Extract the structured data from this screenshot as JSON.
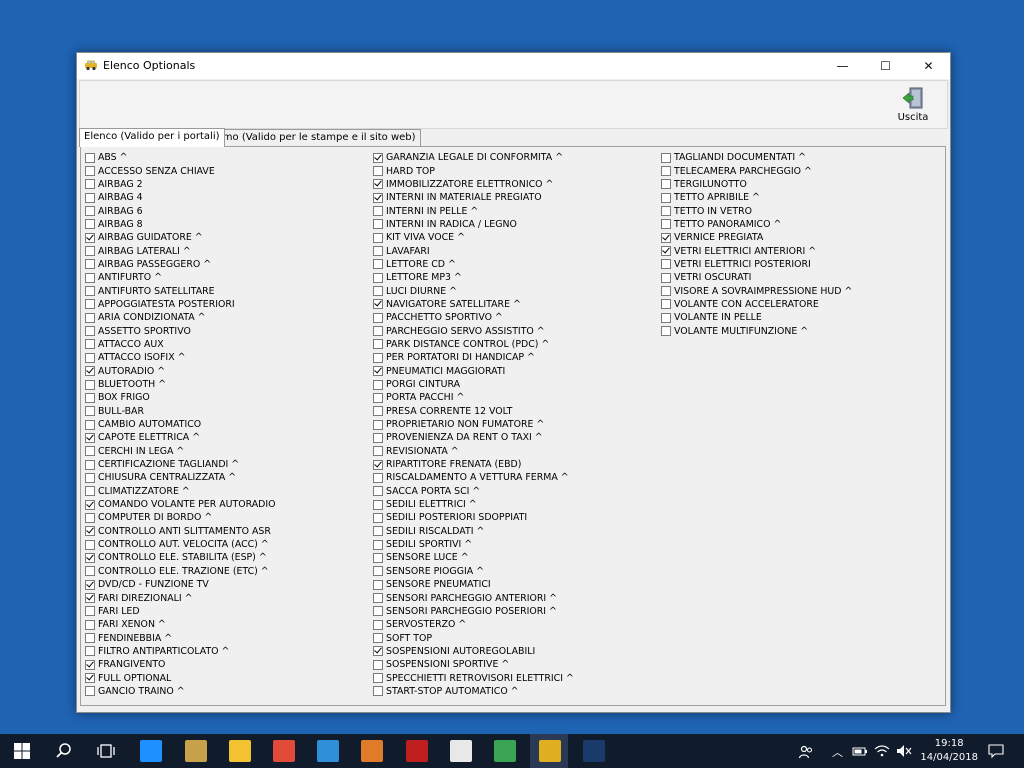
{
  "window": {
    "title": "Elenco Optionals",
    "minimize": "—",
    "maximize": "☐",
    "close": "✕"
  },
  "toolbar": {
    "exit_label": "Uscita"
  },
  "tabs": [
    {
      "label": "Elenco (Valido per i portali)",
      "active": true
    },
    {
      "label": "Memo (Valido per le stampe e il sito web)",
      "active": false
    }
  ],
  "columns": [
    [
      {
        "label": "ABS ^",
        "checked": false
      },
      {
        "label": "ACCESSO SENZA CHIAVE",
        "checked": false
      },
      {
        "label": "AIRBAG 2",
        "checked": false
      },
      {
        "label": "AIRBAG 4",
        "checked": false
      },
      {
        "label": "AIRBAG 6",
        "checked": false
      },
      {
        "label": "AIRBAG 8",
        "checked": false
      },
      {
        "label": "AIRBAG GUIDATORE ^",
        "checked": true
      },
      {
        "label": "AIRBAG LATERALI ^",
        "checked": false
      },
      {
        "label": "AIRBAG PASSEGGERO ^",
        "checked": false
      },
      {
        "label": "ANTIFURTO ^",
        "checked": false
      },
      {
        "label": "ANTIFURTO SATELLITARE",
        "checked": false
      },
      {
        "label": "APPOGGIATESTA POSTERIORI",
        "checked": false
      },
      {
        "label": "ARIA CONDIZIONATA ^",
        "checked": false
      },
      {
        "label": "ASSETTO SPORTIVO",
        "checked": false
      },
      {
        "label": "ATTACCO AUX",
        "checked": false
      },
      {
        "label": "ATTACCO ISOFIX ^",
        "checked": false
      },
      {
        "label": "AUTORADIO ^",
        "checked": true
      },
      {
        "label": "BLUETOOTH ^",
        "checked": false
      },
      {
        "label": "BOX FRIGO",
        "checked": false
      },
      {
        "label": "BULL-BAR",
        "checked": false
      },
      {
        "label": "CAMBIO AUTOMATICO",
        "checked": false
      },
      {
        "label": "CAPOTE ELETTRICA ^",
        "checked": true
      },
      {
        "label": "CERCHI IN LEGA ^",
        "checked": false
      },
      {
        "label": "CERTIFICAZIONE TAGLIANDI ^",
        "checked": false
      },
      {
        "label": "CHIUSURA CENTRALIZZATA ^",
        "checked": false
      },
      {
        "label": "CLIMATIZZATORE ^",
        "checked": false
      },
      {
        "label": "COMANDO VOLANTE PER AUTORADIO",
        "checked": true
      },
      {
        "label": "COMPUTER DI BORDO ^",
        "checked": false
      },
      {
        "label": "CONTROLLO ANTI SLITTAMENTO ASR",
        "checked": true
      },
      {
        "label": "CONTROLLO AUT. VELOCITA (ACC) ^",
        "checked": false
      },
      {
        "label": "CONTROLLO ELE. STABILITA (ESP) ^",
        "checked": true
      },
      {
        "label": "CONTROLLO ELE. TRAZIONE (ETC) ^",
        "checked": false
      },
      {
        "label": "DVD/CD - FUNZIONE TV",
        "checked": true
      },
      {
        "label": "FARI DIREZIONALI ^",
        "checked": true
      },
      {
        "label": "FARI LED",
        "checked": false
      },
      {
        "label": "FARI XENON ^",
        "checked": false
      },
      {
        "label": "FENDINEBBIA ^",
        "checked": false
      },
      {
        "label": "FILTRO ANTIPARTICOLATO ^",
        "checked": false
      },
      {
        "label": "FRANGIVENTO",
        "checked": true
      },
      {
        "label": "FULL OPTIONAL",
        "checked": true
      },
      {
        "label": "GANCIO TRAINO ^",
        "checked": false
      }
    ],
    [
      {
        "label": "GARANZIA LEGALE DI CONFORMITA ^",
        "checked": true
      },
      {
        "label": "HARD TOP",
        "checked": false
      },
      {
        "label": "IMMOBILIZZATORE ELETTRONICO ^",
        "checked": true
      },
      {
        "label": "INTERNI IN MATERIALE PREGIATO",
        "checked": true
      },
      {
        "label": "INTERNI IN PELLE ^",
        "checked": false
      },
      {
        "label": "INTERNI IN RADICA / LEGNO",
        "checked": false
      },
      {
        "label": "KIT VIVA VOCE ^",
        "checked": false
      },
      {
        "label": "LAVAFARI",
        "checked": false
      },
      {
        "label": "LETTORE CD ^",
        "checked": false
      },
      {
        "label": "LETTORE MP3 ^",
        "checked": false
      },
      {
        "label": "LUCI DIURNE ^",
        "checked": false
      },
      {
        "label": "NAVIGATORE SATELLITARE ^",
        "checked": true
      },
      {
        "label": "PACCHETTO SPORTIVO ^",
        "checked": false
      },
      {
        "label": "PARCHEGGIO SERVO ASSISTITO ^",
        "checked": false
      },
      {
        "label": "PARK DISTANCE CONTROL (PDC) ^",
        "checked": false
      },
      {
        "label": "PER PORTATORI DI HANDICAP ^",
        "checked": false
      },
      {
        "label": "PNEUMATICI MAGGIORATI",
        "checked": true
      },
      {
        "label": "PORGI CINTURA",
        "checked": false
      },
      {
        "label": "PORTA PACCHI ^",
        "checked": false
      },
      {
        "label": "PRESA CORRENTE 12 VOLT",
        "checked": false
      },
      {
        "label": "PROPRIETARIO NON FUMATORE ^",
        "checked": false
      },
      {
        "label": "PROVENIENZA DA RENT O TAXI ^",
        "checked": false
      },
      {
        "label": "REVISIONATA ^",
        "checked": false
      },
      {
        "label": "RIPARTITORE FRENATA (EBD)",
        "checked": true
      },
      {
        "label": "RISCALDAMENTO A VETTURA FERMA ^",
        "checked": false
      },
      {
        "label": "SACCA PORTA SCI ^",
        "checked": false
      },
      {
        "label": "SEDILI ELETTRICI ^",
        "checked": false
      },
      {
        "label": "SEDILI POSTERIORI SDOPPIATI",
        "checked": false
      },
      {
        "label": "SEDILI RISCALDATI ^",
        "checked": false
      },
      {
        "label": "SEDILI SPORTIVI ^",
        "checked": false
      },
      {
        "label": "SENSORE LUCE ^",
        "checked": false
      },
      {
        "label": "SENSORE PIOGGIA ^",
        "checked": false
      },
      {
        "label": "SENSORE PNEUMATICI",
        "checked": false
      },
      {
        "label": "SENSORI PARCHEGGIO ANTERIORI ^",
        "checked": false
      },
      {
        "label": "SENSORI PARCHEGGIO POSERIORI ^",
        "checked": false
      },
      {
        "label": "SERVOSTERZO ^",
        "checked": false
      },
      {
        "label": "SOFT TOP",
        "checked": false
      },
      {
        "label": "SOSPENSIONI AUTOREGOLABILI",
        "checked": true
      },
      {
        "label": "SOSPENSIONI SPORTIVE ^",
        "checked": false
      },
      {
        "label": "SPECCHIETTI RETROVISORI ELETTRICI ^",
        "checked": false
      },
      {
        "label": "START-STOP AUTOMATICO ^",
        "checked": false
      }
    ],
    [
      {
        "label": "TAGLIANDI DOCUMENTATI ^",
        "checked": false
      },
      {
        "label": "TELECAMERA PARCHEGGIO ^",
        "checked": false
      },
      {
        "label": "TERGILUNOTTO",
        "checked": false
      },
      {
        "label": "TETTO APRIBILE ^",
        "checked": false
      },
      {
        "label": "TETTO IN VETRO",
        "checked": false
      },
      {
        "label": "TETTO PANORAMICO ^",
        "checked": false
      },
      {
        "label": "VERNICE PREGIATA",
        "checked": true
      },
      {
        "label": "VETRI ELETTRICI ANTERIORI ^",
        "checked": true
      },
      {
        "label": "VETRI ELETTRICI POSTERIORI",
        "checked": false
      },
      {
        "label": "VETRI OSCURATI",
        "checked": false
      },
      {
        "label": "VISORE A SOVRAIMPRESSIONE HUD ^",
        "checked": false
      },
      {
        "label": "VOLANTE CON ACCELERATORE",
        "checked": false
      },
      {
        "label": "VOLANTE IN PELLE",
        "checked": false
      },
      {
        "label": "VOLANTE MULTIFUNZIONE ^",
        "checked": false
      }
    ]
  ],
  "taskbar": {
    "time": "19:18",
    "date": "14/04/2018",
    "apps": [
      {
        "name": "windows-start-icon",
        "color": "#ffffff"
      },
      {
        "name": "search-icon",
        "color": "#ffffff"
      },
      {
        "name": "task-view-icon",
        "color": "#ffffff"
      },
      {
        "name": "edge-icon",
        "color": "#1e90ff"
      },
      {
        "name": "store-icon",
        "color": "#c8a24a"
      },
      {
        "name": "file-explorer-icon",
        "color": "#f2c230"
      },
      {
        "name": "chrome-icon",
        "color": "#e24b3a"
      },
      {
        "name": "vscode-icon",
        "color": "#2f8fd8"
      },
      {
        "name": "media-player-icon",
        "color": "#e07b2a"
      },
      {
        "name": "filezilla-icon",
        "color": "#bf1e1e"
      },
      {
        "name": "7zip-icon",
        "color": "#e8e8e8"
      },
      {
        "name": "colorful-app-icon",
        "color": "#3aa655"
      },
      {
        "name": "optionals-app-icon",
        "color": "#e0b020"
      },
      {
        "name": "photoshop-icon",
        "color": "#1a3a6b"
      }
    ]
  }
}
